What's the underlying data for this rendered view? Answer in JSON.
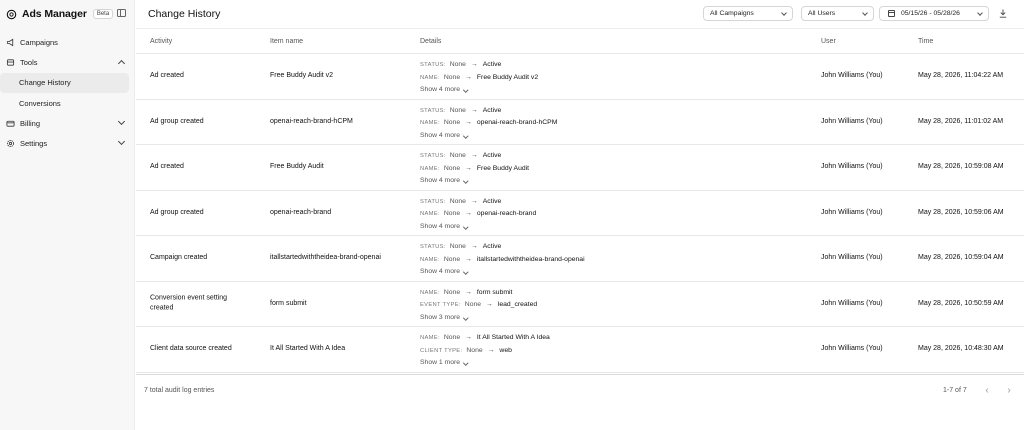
{
  "app": {
    "name": "Ads Manager",
    "badge": "Beta"
  },
  "sidebar": {
    "items": [
      {
        "label": "Campaigns",
        "icon": "megaphone-icon"
      },
      {
        "label": "Tools",
        "icon": "tools-icon",
        "expanded": true,
        "children": [
          {
            "label": "Change History",
            "active": true
          },
          {
            "label": "Conversions"
          }
        ]
      },
      {
        "label": "Billing",
        "icon": "card-icon"
      },
      {
        "label": "Settings",
        "icon": "gear-icon"
      }
    ]
  },
  "header": {
    "title": "Change History",
    "campaign_filter": "All Campaigns",
    "user_filter": "All Users",
    "date_range": "05/15/26 - 05/28/26"
  },
  "table": {
    "columns": [
      "Activity",
      "Item name",
      "Details",
      "User",
      "Time"
    ],
    "rows": [
      {
        "activity": "Ad created",
        "item": "Free Buddy Audit v2",
        "d1k": "STATUS:",
        "d1o": "None",
        "d1n": "Active",
        "d2k": "NAME:",
        "d2o": "None",
        "d2n": "Free Buddy Audit v2",
        "more": "Show 4 more",
        "user": "John Williams (You)",
        "time": "May 28, 2026, 11:04:22 AM"
      },
      {
        "activity": "Ad group created",
        "item": "openai-reach-brand-hCPM",
        "d1k": "STATUS:",
        "d1o": "None",
        "d1n": "Active",
        "d2k": "NAME:",
        "d2o": "None",
        "d2n": "openai-reach-brand-hCPM",
        "more": "Show 4 more",
        "user": "John Williams (You)",
        "time": "May 28, 2026, 11:01:02 AM"
      },
      {
        "activity": "Ad created",
        "item": "Free Buddy Audit",
        "d1k": "STATUS:",
        "d1o": "None",
        "d1n": "Active",
        "d2k": "NAME:",
        "d2o": "None",
        "d2n": "Free Buddy Audit",
        "more": "Show 4 more",
        "user": "John Williams (You)",
        "time": "May 28, 2026, 10:59:08 AM"
      },
      {
        "activity": "Ad group created",
        "item": "openai-reach-brand",
        "d1k": "STATUS:",
        "d1o": "None",
        "d1n": "Active",
        "d2k": "NAME:",
        "d2o": "None",
        "d2n": "openai-reach-brand",
        "more": "Show 4 more",
        "user": "John Williams (You)",
        "time": "May 28, 2026, 10:59:06 AM"
      },
      {
        "activity": "Campaign created",
        "item": "itallstartedwiththeidea-brand-openai",
        "d1k": "STATUS:",
        "d1o": "None",
        "d1n": "Active",
        "d2k": "NAME:",
        "d2o": "None",
        "d2n": "itallstartedwiththeidea-brand-openai",
        "more": "Show 4 more",
        "user": "John Williams (You)",
        "time": "May 28, 2026, 10:59:04 AM"
      },
      {
        "activity": "Conversion event setting created",
        "item": "form submit",
        "d1k": "NAME:",
        "d1o": "None",
        "d1n": "form submit",
        "d2k": "EVENT TYPE:",
        "d2o": "None",
        "d2n": "lead_created",
        "more": "Show 3 more",
        "user": "John Williams (You)",
        "time": "May 28, 2026, 10:50:59 AM"
      },
      {
        "activity": "Client data source created",
        "item": "It All Started With A Idea",
        "d1k": "NAME:",
        "d1o": "None",
        "d1n": "It All Started With A Idea",
        "d2k": "CLIENT TYPE:",
        "d2o": "None",
        "d2n": "web",
        "more": "Show 1 more",
        "user": "John Williams (You)",
        "time": "May 28, 2026, 10:48:30 AM"
      }
    ]
  },
  "footer": {
    "total": "7 total audit log entries",
    "page_info": "1-7 of 7"
  }
}
